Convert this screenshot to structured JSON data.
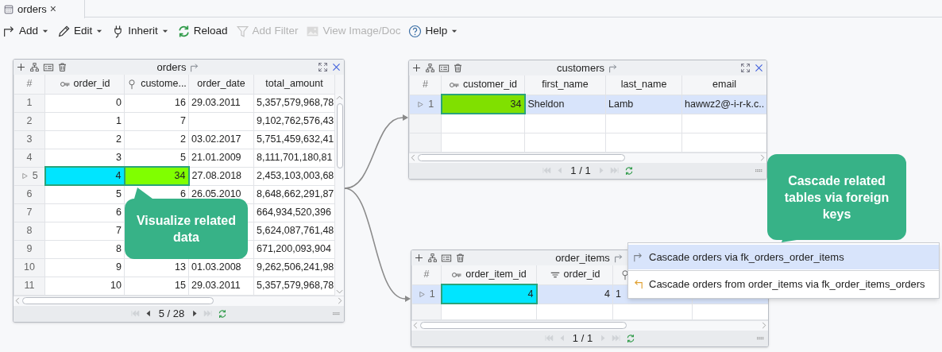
{
  "tab": {
    "label": "orders",
    "close": "×"
  },
  "toolbar": [
    {
      "kind": "add",
      "label": "Add",
      "dropdown": true,
      "disabled": false
    },
    {
      "kind": "edit",
      "label": "Edit",
      "dropdown": true,
      "disabled": false
    },
    {
      "kind": "inherit",
      "label": "Inherit",
      "dropdown": true,
      "disabled": false
    },
    {
      "kind": "reload",
      "label": "Reload",
      "dropdown": false,
      "disabled": false
    },
    {
      "kind": "filter",
      "label": "Add Filter",
      "dropdown": false,
      "disabled": true
    },
    {
      "kind": "image",
      "label": "View Image/Doc",
      "dropdown": false,
      "disabled": true
    },
    {
      "kind": "help",
      "label": "Help",
      "dropdown": true,
      "disabled": false
    }
  ],
  "panels": [
    {
      "title": "orders",
      "columns": [
        {
          "label": "#"
        },
        {
          "label": "order_id",
          "kind": "primary_key"
        },
        {
          "label": "custome...",
          "kind": "foreign_key"
        },
        {
          "label": "order_date"
        },
        {
          "label": "total_amount"
        }
      ],
      "rows": [
        {
          "current": false,
          "selected": false,
          "cells": [
            "1",
            "0",
            "16",
            "29.03.2011",
            "5,357,579,968,78"
          ]
        },
        {
          "current": false,
          "selected": false,
          "cells": [
            "2",
            "1",
            "7",
            null,
            "9,102,762,576,43"
          ]
        },
        {
          "current": false,
          "selected": false,
          "cells": [
            "3",
            "2",
            "2",
            "03.02.2017",
            "5,751,459,632,41"
          ]
        },
        {
          "current": false,
          "selected": false,
          "cells": [
            "4",
            "3",
            "5",
            "21.01.2009",
            "8,111,701,180,81"
          ]
        },
        {
          "current": true,
          "selected": false,
          "cells": [
            "5",
            {
              "text": "4",
              "color": "#00e5ff"
            },
            {
              "text": "34",
              "color": "#80ff00"
            },
            "27.08.2018",
            "2,453,103,003,68"
          ]
        },
        {
          "current": false,
          "selected": false,
          "cells": [
            "6",
            "5",
            "6",
            "26.05.2010",
            "8,648,662,291,87"
          ]
        },
        {
          "current": false,
          "selected": false,
          "cells": [
            "7",
            "6",
            null,
            null,
            "664,934,520,396"
          ]
        },
        {
          "current": false,
          "selected": false,
          "cells": [
            "8",
            "7",
            null,
            null,
            "5,624,087,761,48"
          ]
        },
        {
          "current": false,
          "selected": false,
          "cells": [
            "9",
            "8",
            null,
            null,
            "671,200,093,904"
          ]
        },
        {
          "current": false,
          "selected": false,
          "cells": [
            "10",
            "9",
            "13",
            "01.03.2008",
            "9,262,506,241,98"
          ]
        },
        {
          "current": false,
          "selected": false,
          "cells": [
            "11",
            "10",
            "15",
            "29.03.2011",
            "5,357,579,968,78"
          ]
        }
      ],
      "pager": {
        "text": "5 / 28",
        "first": false,
        "prev": true,
        "next": true,
        "last": false
      }
    },
    {
      "title": "customers",
      "columns": [
        {
          "label": "#"
        },
        {
          "label": "customer_id",
          "kind": "primary_key"
        },
        {
          "label": "first_name"
        },
        {
          "label": "last_name"
        },
        {
          "label": "email"
        }
      ],
      "rows": [
        {
          "current": true,
          "selected": true,
          "cells": [
            "1",
            {
              "text": "34",
              "color": "#80e000"
            },
            "Sheldon",
            "Lamb",
            "hawwz2@-i-r-k.c.."
          ]
        }
      ],
      "pager": {
        "text": "1 / 1",
        "first": false,
        "prev": false,
        "next": false,
        "last": false
      }
    },
    {
      "title": "order_items",
      "columns": [
        {
          "label": "#"
        },
        {
          "label": "order_item_id",
          "kind": "primary_key"
        },
        {
          "label": "order_id",
          "kind": "indexed"
        },
        {
          "kind": "foreign_key"
        },
        {}
      ],
      "rows": [
        {
          "current": true,
          "selected": true,
          "cells": [
            "1",
            {
              "text": "4",
              "color": "#00e5ff"
            },
            "4",
            "1",
            null
          ]
        }
      ],
      "pager": {
        "text": "1 / 1",
        "first": false,
        "prev": false,
        "next": false,
        "last": false
      }
    }
  ],
  "menu": [
    {
      "kind": "forward",
      "label": "Cascade orders via fk_orders_order_items",
      "selected": true
    },
    {
      "kind": "back",
      "label": "Cascade orders from order_items via fk_order_items_orders",
      "selected": false
    }
  ],
  "callouts": [
    {
      "text": "Visualize related data"
    },
    {
      "text": "Cascade related tables via foreign keys"
    }
  ]
}
